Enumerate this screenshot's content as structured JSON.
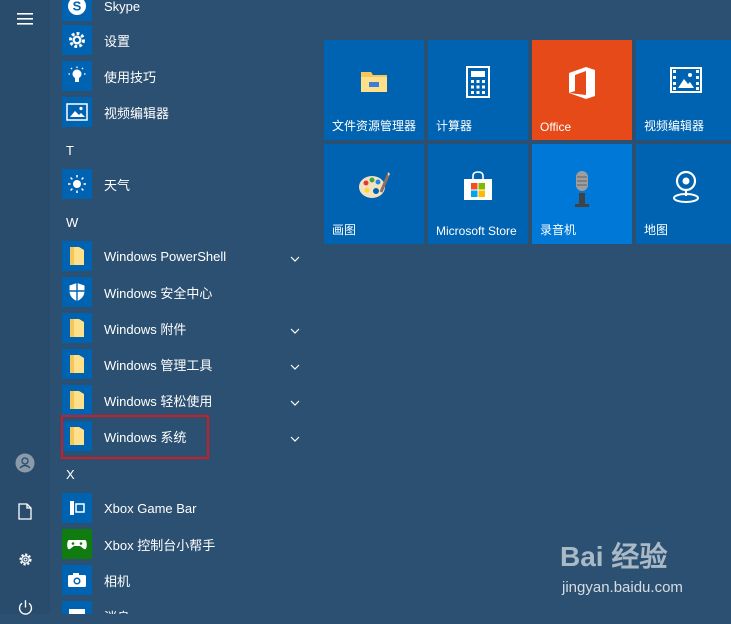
{
  "apps": {
    "skype": "Skype",
    "settings": "设置",
    "tips": "使用技巧",
    "video_editor": "视频编辑器",
    "letter_t": "T",
    "weather": "天气",
    "letter_w": "W",
    "powershell": "Windows PowerShell",
    "security": "Windows 安全中心",
    "accessories": "Windows 附件",
    "admin_tools": "Windows 管理工具",
    "ease_access": "Windows 轻松使用",
    "system": "Windows 系统",
    "letter_x": "X",
    "xbox_bar": "Xbox Game Bar",
    "xbox_companion": "Xbox 控制台小帮手",
    "camera": "相机",
    "last_partial": "消息"
  },
  "tiles": {
    "explorer": "文件资源管理器",
    "calculator": "计算器",
    "office": "Office",
    "video_editor": "视频编辑器",
    "paint": "画图",
    "store": "Microsoft Store",
    "recorder": "录音机",
    "maps": "地图"
  },
  "colors": {
    "background": "#2c5071",
    "tile": "#0063b1",
    "tile_light": "#0078d7",
    "office": "#e64a19",
    "highlight_box": "#d11a22"
  },
  "icons": {
    "rail": [
      "hamburger-menu-icon",
      "user-avatar-icon",
      "document-icon",
      "gear-icon",
      "power-icon"
    ]
  },
  "watermark": {
    "brand": "Bai 经验",
    "url": "jingyan.baidu.com"
  }
}
